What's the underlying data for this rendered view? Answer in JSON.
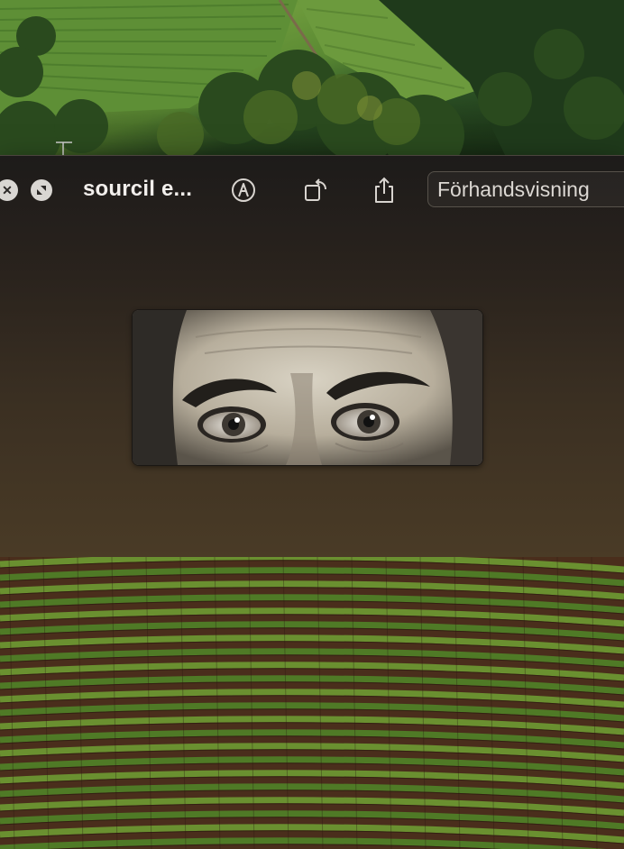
{
  "window": {
    "title": "sourcil e...",
    "open_with_label": "Förhandsvisning"
  },
  "toolbar": {
    "close_icon": "close-icon",
    "fullscreen_icon": "fullscreen-icon",
    "markup_icon": "markup-pen-icon",
    "rotate_icon": "rotate-left-icon",
    "share_icon": "share-icon"
  },
  "preview": {
    "subject": "vintage photo of eyes and eyebrows"
  },
  "colors": {
    "window_top": "#1d1b1a",
    "window_bottom": "#4a3b26",
    "title_text": "#f2efec",
    "button_border": "#57524b"
  }
}
